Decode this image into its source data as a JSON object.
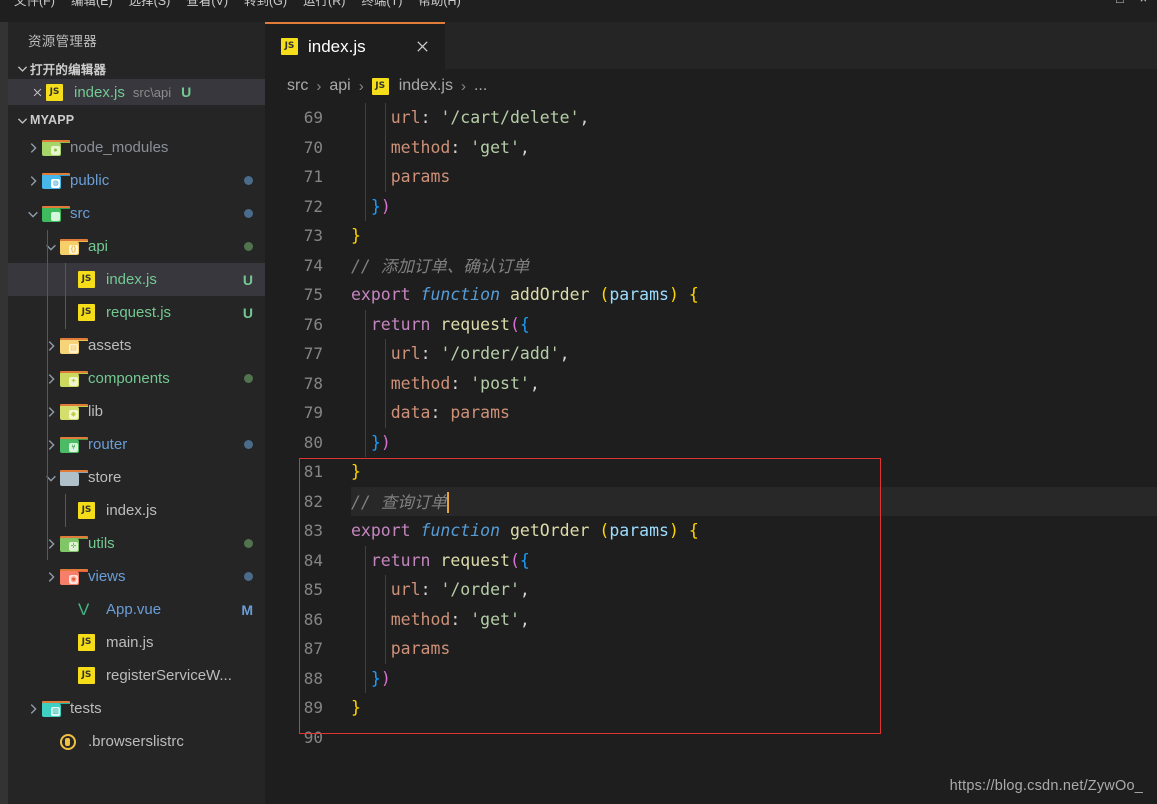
{
  "window": {
    "menu_items": [
      "文件(F)",
      "编辑(E)",
      "选择(S)",
      "查看(V)",
      "转到(G)",
      "运行(R)",
      "终端(T)",
      "帮助(H)"
    ],
    "menu_right": [
      "□",
      "×"
    ]
  },
  "sidebar": {
    "title": "资源管理器",
    "open_editors": {
      "header": "打开的编辑器",
      "items": [
        {
          "name": "index.js",
          "path": "src\\api",
          "badge": "U",
          "icon": "js-file-icon",
          "close_icon": "close-icon"
        }
      ]
    },
    "project": {
      "header": "MYAPP",
      "tree": [
        {
          "label": "node_modules",
          "icon": "folder-node-modules-icon",
          "arrow": "chevron-right",
          "depth": 1,
          "color": "#8a8f98",
          "badge": "",
          "badge_color": "",
          "dot": ""
        },
        {
          "label": "public",
          "icon": "folder-public-icon",
          "arrow": "chevron-right",
          "depth": 1,
          "color": "#6a9ed6",
          "badge": "",
          "badge_color": "",
          "dot": "#4a6b8a"
        },
        {
          "label": "src",
          "icon": "folder-src-icon",
          "arrow": "chevron-down",
          "depth": 1,
          "color": "#6a9ed6",
          "badge": "",
          "badge_color": "",
          "dot": "#4a6b8a"
        },
        {
          "label": "api",
          "icon": "folder-api-icon",
          "arrow": "chevron-down",
          "depth": 2,
          "color": "#73c991",
          "badge": "",
          "badge_color": "",
          "dot": "#51744e"
        },
        {
          "label": "index.js",
          "icon": "js-file-icon",
          "arrow": "none",
          "depth": 3,
          "color": "#73c991",
          "badge": "U",
          "badge_color": "#73c991",
          "dot": "",
          "selected": true
        },
        {
          "label": "request.js",
          "icon": "js-file-icon",
          "arrow": "none",
          "depth": 3,
          "color": "#73c991",
          "badge": "U",
          "badge_color": "#73c991",
          "dot": ""
        },
        {
          "label": "assets",
          "icon": "folder-assets-icon",
          "arrow": "chevron-right",
          "depth": 2,
          "color": "#bcbcbc",
          "badge": "",
          "badge_color": "",
          "dot": ""
        },
        {
          "label": "components",
          "icon": "folder-components-icon",
          "arrow": "chevron-right",
          "depth": 2,
          "color": "#73c991",
          "badge": "",
          "badge_color": "",
          "dot": "#51744e"
        },
        {
          "label": "lib",
          "icon": "folder-lib-icon",
          "arrow": "chevron-right",
          "depth": 2,
          "color": "#bcbcbc",
          "badge": "",
          "badge_color": "",
          "dot": ""
        },
        {
          "label": "router",
          "icon": "folder-router-icon",
          "arrow": "chevron-right",
          "depth": 2,
          "color": "#6a9ed6",
          "badge": "",
          "badge_color": "",
          "dot": "#4a6b8a"
        },
        {
          "label": "store",
          "icon": "folder-plain-icon",
          "arrow": "chevron-down",
          "depth": 2,
          "color": "#bcbcbc",
          "badge": "",
          "badge_color": "",
          "dot": ""
        },
        {
          "label": "index.js",
          "icon": "js-file-icon",
          "arrow": "none",
          "depth": 3,
          "color": "#bcbcbc",
          "badge": "",
          "badge_color": "",
          "dot": ""
        },
        {
          "label": "utils",
          "icon": "folder-utils-icon",
          "arrow": "chevron-right",
          "depth": 2,
          "color": "#73c991",
          "badge": "",
          "badge_color": "",
          "dot": "#51744e"
        },
        {
          "label": "views",
          "icon": "folder-views-icon",
          "arrow": "chevron-right",
          "depth": 2,
          "color": "#6a9ed6",
          "badge": "",
          "badge_color": "",
          "dot": "#4a6b8a"
        },
        {
          "label": "App.vue",
          "icon": "vue-file-icon",
          "arrow": "none",
          "depth": 3,
          "color": "#6a9ed6",
          "badge": "M",
          "badge_color": "#6a9ed6",
          "dot": ""
        },
        {
          "label": "main.js",
          "icon": "js-file-icon",
          "arrow": "none",
          "depth": 3,
          "color": "#bcbcbc",
          "badge": "",
          "badge_color": "",
          "dot": ""
        },
        {
          "label": "registerServiceW...",
          "icon": "js-file-icon",
          "arrow": "none",
          "depth": 3,
          "color": "#bcbcbc",
          "badge": "",
          "badge_color": "",
          "dot": ""
        },
        {
          "label": "tests",
          "icon": "folder-tests-icon",
          "arrow": "chevron-right",
          "depth": 1,
          "color": "#bcbcbc",
          "badge": "",
          "badge_color": "",
          "dot": ""
        },
        {
          "label": ".browserslistrc",
          "icon": "browserslist-icon",
          "arrow": "none",
          "depth": 2,
          "color": "#bcbcbc",
          "badge": "",
          "badge_color": "",
          "dot": ""
        }
      ]
    }
  },
  "tabs": [
    {
      "label": "index.js",
      "icon": "js-file-icon",
      "close_icon": "close-icon",
      "active": true
    }
  ],
  "breadcrumb": {
    "items": [
      "src",
      "api",
      "index.js",
      "..."
    ],
    "separator": "›",
    "file_icon": "js-file-icon"
  },
  "editor": {
    "first_line_number": 69,
    "cursor_line": 82,
    "lines": [
      {
        "n": 69,
        "indent": 2,
        "tokens": [
          {
            "t": "    ",
            "c": "tk-punct"
          },
          {
            "t": "url",
            "c": "tk-prop"
          },
          {
            "t": ": ",
            "c": "tk-punct"
          },
          {
            "t": "'/cart/delete'",
            "c": "tk-str"
          },
          {
            "t": ",",
            "c": "tk-punct"
          }
        ]
      },
      {
        "n": 70,
        "indent": 2,
        "tokens": [
          {
            "t": "    ",
            "c": "tk-punct"
          },
          {
            "t": "method",
            "c": "tk-prop"
          },
          {
            "t": ": ",
            "c": "tk-punct"
          },
          {
            "t": "'get'",
            "c": "tk-str"
          },
          {
            "t": ",",
            "c": "tk-punct"
          }
        ]
      },
      {
        "n": 71,
        "indent": 2,
        "tokens": [
          {
            "t": "    ",
            "c": "tk-punct"
          },
          {
            "t": "params",
            "c": "tk-prop"
          }
        ]
      },
      {
        "n": 72,
        "indent": 1,
        "tokens": [
          {
            "t": "  ",
            "c": "tk-punct"
          },
          {
            "t": "}",
            "c": "tk-b-blue"
          },
          {
            "t": ")",
            "c": "tk-b-pink"
          }
        ]
      },
      {
        "n": 73,
        "indent": 0,
        "tokens": [
          {
            "t": "}",
            "c": "tk-b-yellow"
          }
        ]
      },
      {
        "n": 74,
        "indent": 0,
        "tokens": [
          {
            "t": "// 添加订单、确认订单",
            "c": "tk-cmt-gray"
          }
        ]
      },
      {
        "n": 75,
        "indent": 0,
        "tokens": [
          {
            "t": "export ",
            "c": "tk-key"
          },
          {
            "t": "function",
            "c": "tk-fn"
          },
          {
            "t": " ",
            "c": "tk-punct"
          },
          {
            "t": "addOrder",
            "c": "tk-fname"
          },
          {
            "t": " ",
            "c": "tk-punct"
          },
          {
            "t": "(",
            "c": "tk-b-yellow"
          },
          {
            "t": "params",
            "c": "tk-var"
          },
          {
            "t": ")",
            "c": "tk-b-yellow"
          },
          {
            "t": " ",
            "c": "tk-punct"
          },
          {
            "t": "{",
            "c": "tk-b-yellow"
          }
        ]
      },
      {
        "n": 76,
        "indent": 1,
        "tokens": [
          {
            "t": "  ",
            "c": "tk-punct"
          },
          {
            "t": "return",
            "c": "tk-ret"
          },
          {
            "t": " ",
            "c": "tk-punct"
          },
          {
            "t": "request",
            "c": "tk-call"
          },
          {
            "t": "(",
            "c": "tk-b-pink"
          },
          {
            "t": "{",
            "c": "tk-b-blue"
          }
        ]
      },
      {
        "n": 77,
        "indent": 2,
        "tokens": [
          {
            "t": "    ",
            "c": "tk-punct"
          },
          {
            "t": "url",
            "c": "tk-prop"
          },
          {
            "t": ": ",
            "c": "tk-punct"
          },
          {
            "t": "'/order/add'",
            "c": "tk-str"
          },
          {
            "t": ",",
            "c": "tk-punct"
          }
        ]
      },
      {
        "n": 78,
        "indent": 2,
        "tokens": [
          {
            "t": "    ",
            "c": "tk-punct"
          },
          {
            "t": "method",
            "c": "tk-prop"
          },
          {
            "t": ": ",
            "c": "tk-punct"
          },
          {
            "t": "'post'",
            "c": "tk-str"
          },
          {
            "t": ",",
            "c": "tk-punct"
          }
        ]
      },
      {
        "n": 79,
        "indent": 2,
        "tokens": [
          {
            "t": "    ",
            "c": "tk-punct"
          },
          {
            "t": "data",
            "c": "tk-prop"
          },
          {
            "t": ": ",
            "c": "tk-punct"
          },
          {
            "t": "params",
            "c": "tk-prop"
          }
        ]
      },
      {
        "n": 80,
        "indent": 1,
        "tokens": [
          {
            "t": "  ",
            "c": "tk-punct"
          },
          {
            "t": "}",
            "c": "tk-b-blue"
          },
          {
            "t": ")",
            "c": "tk-b-pink"
          }
        ]
      },
      {
        "n": 81,
        "indent": 0,
        "tokens": [
          {
            "t": "}",
            "c": "tk-b-yellow"
          }
        ]
      },
      {
        "n": 82,
        "indent": 0,
        "current": true,
        "tokens": [
          {
            "t": "// 查询订单",
            "c": "tk-cmt-gray"
          }
        ]
      },
      {
        "n": 83,
        "indent": 0,
        "tokens": [
          {
            "t": "export ",
            "c": "tk-key"
          },
          {
            "t": "function",
            "c": "tk-fn"
          },
          {
            "t": " ",
            "c": "tk-punct"
          },
          {
            "t": "getOrder",
            "c": "tk-fname"
          },
          {
            "t": " ",
            "c": "tk-punct"
          },
          {
            "t": "(",
            "c": "tk-b-yellow"
          },
          {
            "t": "params",
            "c": "tk-var"
          },
          {
            "t": ")",
            "c": "tk-b-yellow"
          },
          {
            "t": " ",
            "c": "tk-punct"
          },
          {
            "t": "{",
            "c": "tk-b-yellow"
          }
        ]
      },
      {
        "n": 84,
        "indent": 1,
        "tokens": [
          {
            "t": "  ",
            "c": "tk-punct"
          },
          {
            "t": "return",
            "c": "tk-ret"
          },
          {
            "t": " ",
            "c": "tk-punct"
          },
          {
            "t": "request",
            "c": "tk-call"
          },
          {
            "t": "(",
            "c": "tk-b-pink"
          },
          {
            "t": "{",
            "c": "tk-b-blue"
          }
        ]
      },
      {
        "n": 85,
        "indent": 2,
        "tokens": [
          {
            "t": "    ",
            "c": "tk-punct"
          },
          {
            "t": "url",
            "c": "tk-prop"
          },
          {
            "t": ": ",
            "c": "tk-punct"
          },
          {
            "t": "'/order'",
            "c": "tk-str"
          },
          {
            "t": ",",
            "c": "tk-punct"
          }
        ]
      },
      {
        "n": 86,
        "indent": 2,
        "tokens": [
          {
            "t": "    ",
            "c": "tk-punct"
          },
          {
            "t": "method",
            "c": "tk-prop"
          },
          {
            "t": ": ",
            "c": "tk-punct"
          },
          {
            "t": "'get'",
            "c": "tk-str"
          },
          {
            "t": ",",
            "c": "tk-punct"
          }
        ]
      },
      {
        "n": 87,
        "indent": 2,
        "tokens": [
          {
            "t": "    ",
            "c": "tk-punct"
          },
          {
            "t": "params",
            "c": "tk-prop"
          }
        ]
      },
      {
        "n": 88,
        "indent": 1,
        "tokens": [
          {
            "t": "  ",
            "c": "tk-punct"
          },
          {
            "t": "}",
            "c": "tk-b-blue"
          },
          {
            "t": ")",
            "c": "tk-b-pink"
          }
        ]
      },
      {
        "n": 89,
        "indent": 0,
        "tokens": [
          {
            "t": "}",
            "c": "tk-b-yellow"
          }
        ]
      },
      {
        "n": 90,
        "indent": 0,
        "tokens": []
      }
    ]
  },
  "annotation": {
    "color": "#e03434",
    "shape": "rectangle"
  },
  "watermark": {
    "text": "https://blog.csdn.net/ZywOo_"
  },
  "colors": {
    "editor_bg": "#1e1e1e",
    "sidebar_bg": "#252526",
    "selection_bg": "#37373d",
    "tab_active_border": "#e07b39",
    "cursor": "#e8a33d",
    "annotation_red": "#e03434"
  }
}
